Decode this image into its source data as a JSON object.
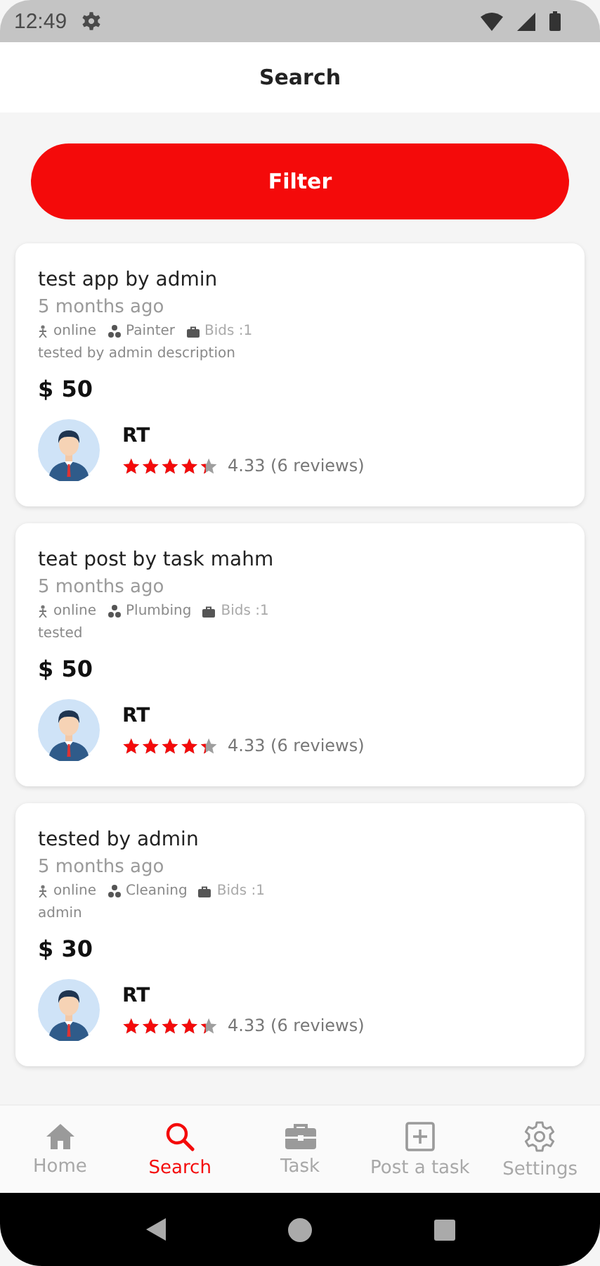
{
  "status_bar": {
    "time": "12:49"
  },
  "app_bar": {
    "title": "Search"
  },
  "filter_button": {
    "label": "Filter"
  },
  "tasks": [
    {
      "title": "test app by admin",
      "posted": "5 months ago",
      "mode": "online",
      "category": "Painter",
      "bids": "Bids :1",
      "description": "tested by admin description",
      "price": "$ 50",
      "user": {
        "name": "RT",
        "stars": 4.33,
        "rating": "4.33 (6 reviews)"
      }
    },
    {
      "title": "teat post by task mahm",
      "posted": "5 months ago",
      "mode": "online",
      "category": "Plumbing",
      "bids": "Bids :1",
      "description": "tested",
      "price": "$ 50",
      "user": {
        "name": "RT",
        "stars": 4.33,
        "rating": "4.33 (6 reviews)"
      }
    },
    {
      "title": "tested by admin",
      "posted": "5 months ago",
      "mode": "online",
      "category": "Cleaning",
      "bids": "Bids :1",
      "description": "admin",
      "price": "$ 30",
      "user": {
        "name": "RT",
        "stars": 4.33,
        "rating": "4.33 (6 reviews)"
      }
    }
  ],
  "bottom_nav": [
    {
      "kind": "home",
      "label": "Home",
      "selected": false
    },
    {
      "kind": "search",
      "label": "Search",
      "selected": true
    },
    {
      "kind": "task",
      "label": "Task",
      "selected": false
    },
    {
      "kind": "post",
      "label": "Post a task",
      "selected": false
    },
    {
      "kind": "settings",
      "label": "Settings",
      "selected": false
    }
  ]
}
